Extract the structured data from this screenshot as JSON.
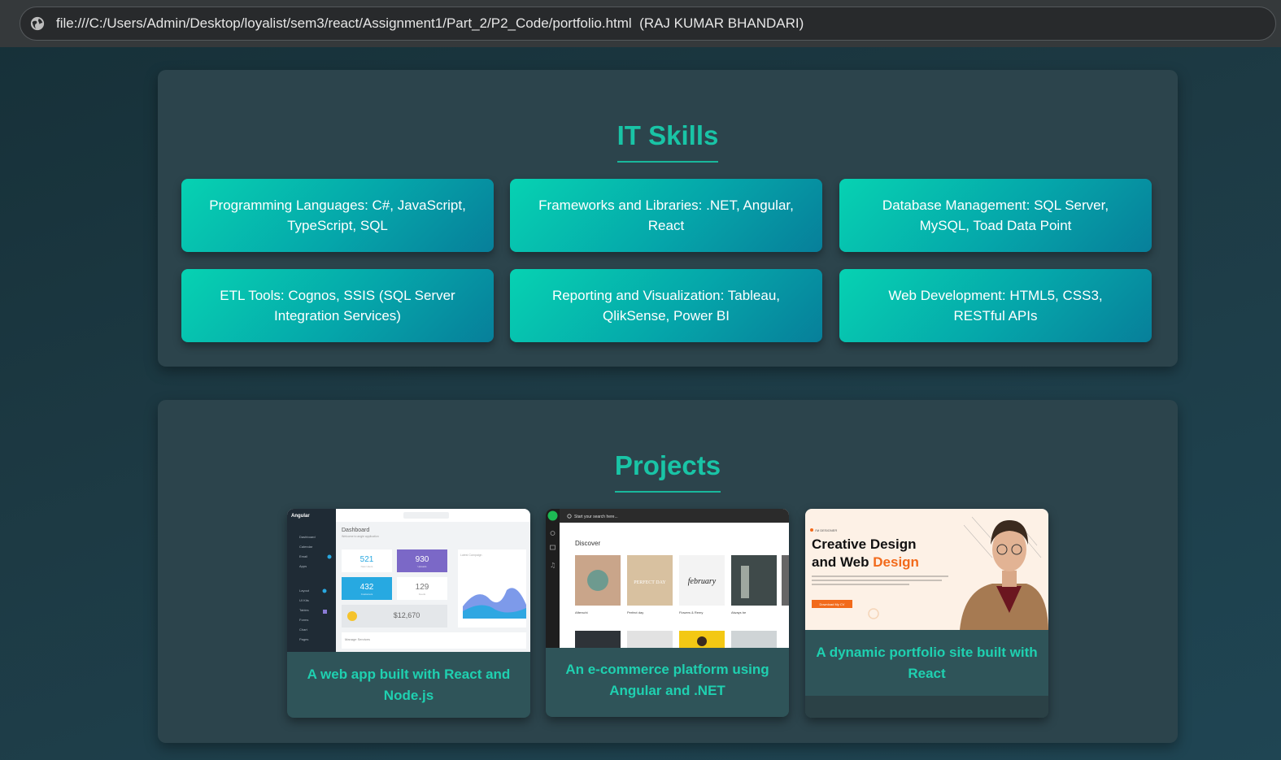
{
  "browser": {
    "url": "file:///C:/Users/Admin/Desktop/loyalist/sem3/react/Assignment1/Part_2/P2_Code/portfolio.html",
    "tab_title": "(RAJ KUMAR BHANDARI)",
    "site_info_icon": "globe-icon"
  },
  "skills": {
    "title": "IT Skills",
    "items": [
      "Programming Languages: C#, JavaScript, TypeScript, SQL",
      "Frameworks and Libraries: .NET, Angular, React",
      "Database Management: SQL Server, MySQL, Toad Data Point",
      "ETL Tools: Cognos, SSIS (SQL Server Integration Services)",
      "Reporting and Visualization: Tableau, QlikSense, Power BI",
      "Web Development: HTML5, CSS3, RESTful APIs"
    ]
  },
  "projects": {
    "title": "Projects",
    "items": [
      {
        "caption": "A web app built with React and Node.js",
        "preview": {
          "brand": "Angular",
          "nav": [
            "Dashboard",
            "Calendar",
            "Email",
            "Apps",
            "Layout",
            "UI Kits",
            "Tables",
            "Forms",
            "Chart",
            "Pages"
          ],
          "heading": "Dashboard",
          "subheading": "Welcome to angle application",
          "stats": [
            {
              "value": "521",
              "label": "New Users"
            },
            {
              "value": "930",
              "label": "Uploads"
            },
            {
              "value": "432",
              "label": "Customers"
            },
            {
              "value": "129",
              "label": "Feeds"
            }
          ],
          "money": "$12,670",
          "chart_title": "Latest Campaign",
          "footer": "Manage Services"
        }
      },
      {
        "caption": "An e-commerce platform using Angular and .NET",
        "preview": {
          "search_placeholder": "Start your search here...",
          "heading": "Discover",
          "albums": [
            "Afterschi",
            "Perfect day",
            "Flowers & Remy",
            "Always be"
          ],
          "album_art_text": [
            "PERFECT DAY",
            "february"
          ]
        }
      },
      {
        "caption": "A dynamic portfolio site built with React",
        "preview": {
          "kicker": "I'M DESIGNER",
          "headline_1": "Creative Design",
          "headline_2a": "and Web",
          "headline_2b": "Design",
          "button": "Download My CV"
        }
      }
    ]
  },
  "colors": {
    "accent": "#19c4a6",
    "card_gradient_start": "#06d2b2",
    "card_gradient_end": "#077f9a",
    "section_bg": "#2c444c",
    "orange": "#f26a1b"
  }
}
